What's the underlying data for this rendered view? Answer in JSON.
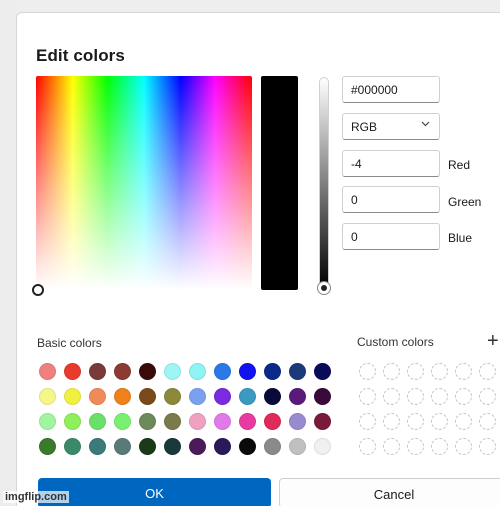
{
  "dialog": {
    "title": "Edit colors"
  },
  "picker": {
    "hex_value": "#000000",
    "mode_value": "RGB",
    "red_value": "-4",
    "green_value": "0",
    "blue_value": "0",
    "red_label": "Red",
    "green_label": "Green",
    "blue_label": "Blue",
    "selected_color": "#000000"
  },
  "basic_colors": {
    "label": "Basic colors",
    "swatches": [
      "#f08080",
      "#e83b2e",
      "#7a3a3a",
      "#8b3b33",
      "#3a0a0a",
      "#9ff5f5",
      "#8ef3f3",
      "#2a79e6",
      "#1212f0",
      "#0a2a8a",
      "#1a3a7a",
      "#0a0a5a",
      "#f5f58a",
      "#f0f040",
      "#f08a5a",
      "#f0801a",
      "#7a4a1a",
      "#8a8a3a",
      "#7aa0f0",
      "#7a2ae0",
      "#3a9ac0",
      "#0a0a3a",
      "#5a1a7a",
      "#3a0a3a",
      "#a0f5a0",
      "#8ef05a",
      "#6ae06a",
      "#7af070",
      "#6a8a5a",
      "#7a7a4a",
      "#f0a0c0",
      "#e07ae8",
      "#e83aa0",
      "#e02a5a",
      "#9a8ad0",
      "#7a1a3a",
      "#3a7a2a",
      "#3a8a6a",
      "#3a7a7a",
      "#5a7a7a",
      "#1a3a1a",
      "#1a3a3a",
      "#4a1a5a",
      "#2a1a5a",
      "#0a0a0a",
      "#8a8a8a",
      "#c0c0c0",
      "#f0f0f0"
    ]
  },
  "custom_colors": {
    "label": "Custom colors",
    "add_label": "+"
  },
  "buttons": {
    "ok": "OK",
    "cancel": "Cancel"
  },
  "watermark": "imgflip.com"
}
